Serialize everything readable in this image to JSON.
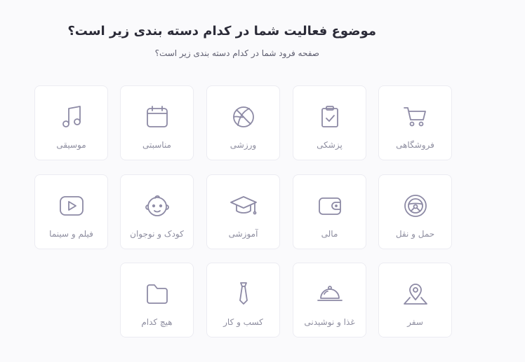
{
  "header": {
    "title": "موضوع فعالیت شما در کدام دسته بندی زیر است؟",
    "subtitle": "صفحه فرود شما در کدام دسته بندی زیر است؟"
  },
  "categories": [
    {
      "label": "فروشگاهی",
      "icon": "cart-icon"
    },
    {
      "label": "پزشکی",
      "icon": "clipboard-check-icon"
    },
    {
      "label": "ورزشی",
      "icon": "basketball-icon"
    },
    {
      "label": "مناسبتی",
      "icon": "calendar-icon"
    },
    {
      "label": "موسیقی",
      "icon": "music-note-icon"
    },
    {
      "label": "حمل و نقل",
      "icon": "steering-wheel-icon"
    },
    {
      "label": "مالی",
      "icon": "wallet-icon"
    },
    {
      "label": "آموزشی",
      "icon": "graduation-cap-icon"
    },
    {
      "label": "کودک و نوجوان",
      "icon": "baby-face-icon"
    },
    {
      "label": "فیلم و سینما",
      "icon": "video-play-icon"
    },
    {
      "label": "سفر",
      "icon": "map-pin-icon"
    },
    {
      "label": "غذا و نوشیدنی",
      "icon": "food-cloche-icon"
    },
    {
      "label": "کسب و کار",
      "icon": "necktie-icon"
    },
    {
      "label": "هیچ کدام",
      "icon": "folder-icon"
    }
  ],
  "colors": {
    "icon": "#8d8aa5",
    "label": "#8e8ea0",
    "title": "#2b2b38"
  }
}
